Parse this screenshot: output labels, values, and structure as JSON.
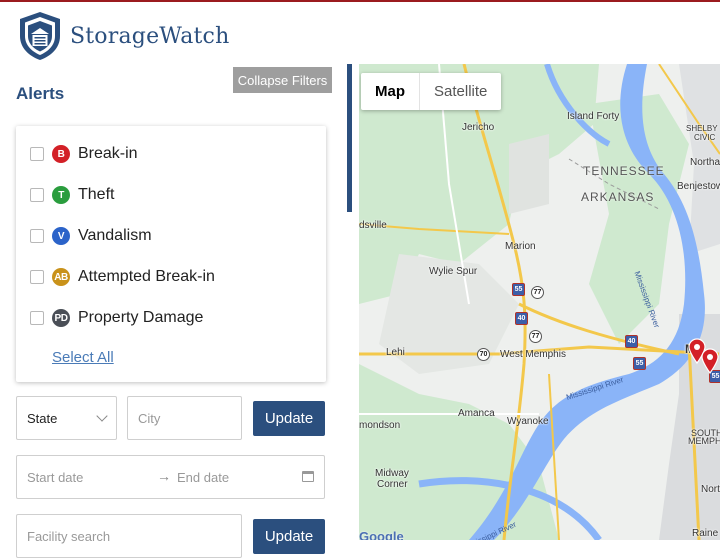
{
  "brand": {
    "name": "StorageWatch"
  },
  "filters": {
    "collapse_label": "Collapse Filters",
    "alerts_title": "Alerts",
    "alert_types": [
      {
        "code": "B",
        "label": "Break-in",
        "color": "#d32027"
      },
      {
        "code": "T",
        "label": "Theft",
        "color": "#2a9d3e"
      },
      {
        "code": "V",
        "label": "Vandalism",
        "color": "#2b63c9"
      },
      {
        "code": "AB",
        "label": "Attempted Break-in",
        "color": "#c9921a"
      },
      {
        "code": "PD",
        "label": "Property Damage",
        "color": "#4a4f57"
      }
    ],
    "select_all_label": "Select All",
    "state": {
      "value": "State"
    },
    "city": {
      "placeholder": "City"
    },
    "update_label": "Update",
    "dates": {
      "start_placeholder": "Start date",
      "arrow": "→",
      "end_placeholder": "End date"
    },
    "facility": {
      "placeholder": "Facility search"
    },
    "update2_label": "Update"
  },
  "map": {
    "toggle": [
      {
        "label": "Map",
        "active": true
      },
      {
        "label": "Satellite",
        "active": false
      }
    ],
    "places": [
      "Jericho",
      "Island Forty",
      "SHELBY",
      "CIVIC",
      "Northa",
      "Benjestow",
      "dsville",
      "Marion",
      "Wylie Spur",
      "Lehi",
      "West Memphis",
      "M",
      "mondson",
      "Amanca",
      "Wyanoke",
      "SOUTH",
      "MEMPHI",
      "Midway",
      "Corner",
      "Raine",
      "North"
    ],
    "states": [
      "TENNESSEE",
      "ARKANSAS"
    ],
    "river": "Mississippi River",
    "shields": [
      "55",
      "77",
      "40",
      "77",
      "55",
      "70",
      "40",
      "55"
    ],
    "google": "Google"
  }
}
